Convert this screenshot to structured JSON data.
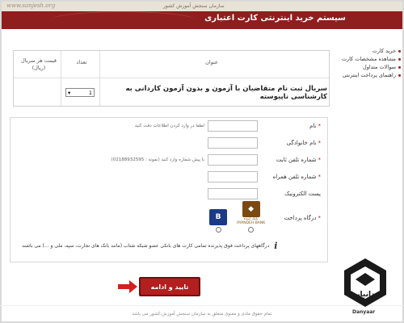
{
  "header": {
    "site": "www.sanjesh.org",
    "org": "سازمان سنجش آموزش کشور",
    "title": "سیستم خرید اینترنتی کارت اعتباری"
  },
  "sidebar": {
    "items": [
      {
        "label": "خرید کارت"
      },
      {
        "label": "مشاهده مشخصات کارت"
      },
      {
        "label": "سوالات متداول"
      },
      {
        "label": "راهنمای پرداخت اینترنتی"
      }
    ]
  },
  "product_table": {
    "col_title": "عنوان",
    "col_qty": "تعداد",
    "col_price": "قیمت هر سریال (ریال)",
    "item_title": "سریال ثبت نام متقاضیان با آزمون و بدون آزمون کاردانی به کارشناسی ناپیوسته",
    "qty_value": "1"
  },
  "form": {
    "fields": [
      {
        "label": "نام",
        "required": true,
        "hint": "لطفا در وارد کردن اطلاعات دقت کنید"
      },
      {
        "label": "نام خانوادگی",
        "required": true,
        "hint": ""
      },
      {
        "label": "شماره تلفن ثابت",
        "required": true,
        "hint": "با پیش شماره وارد کنید (نمونه : 02188932595)"
      },
      {
        "label": "شماره تلفن همراه",
        "required": true,
        "hint": ""
      },
      {
        "label": "پست الکترونیک",
        "required": false,
        "hint": ""
      }
    ],
    "gateway_label": "درگاه پرداخت",
    "banks": [
      {
        "name": "بانک آینده",
        "sub": "AYANDEH BANK",
        "color": "#7a4a12"
      },
      {
        "name": "بانک ملی",
        "color": "#1b3a86"
      }
    ],
    "note": "درگاههای پرداخت فوق پذیرنده تمامی کارت های بانکی عضو شبکه شتاب (مانند بانک های تجارت، سپه، ملی و ...) می باشند"
  },
  "submit_label": "تایید و ادامه",
  "footer": "تمام حقوق مادی و معنوی متعلق به سازمان سنجش آموزش کشور می باشد",
  "watermark": {
    "text": "Danyaar",
    "brand": "دانیار"
  },
  "colors": {
    "brand": "#8f1e1e",
    "button": "#b31e1e"
  }
}
